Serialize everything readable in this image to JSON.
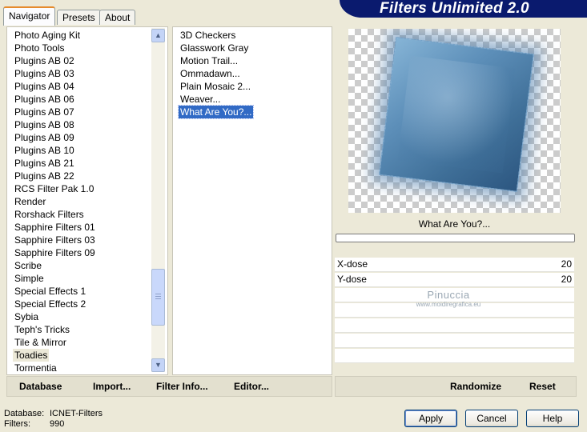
{
  "tabs": [
    "Navigator",
    "Presets",
    "About"
  ],
  "banner_title": "Filters Unlimited 2.0",
  "categories": [
    "Photo Aging Kit",
    "Photo Tools",
    "Plugins AB 02",
    "Plugins AB 03",
    "Plugins AB 04",
    "Plugins AB 06",
    "Plugins AB 07",
    "Plugins AB 08",
    "Plugins AB 09",
    "Plugins AB 10",
    "Plugins AB 21",
    "Plugins AB 22",
    "RCS Filter Pak 1.0",
    "Render",
    "Rorshack Filters",
    "Sapphire Filters 01",
    "Sapphire Filters 03",
    "Sapphire Filters 09",
    "Scribe",
    "Simple",
    "Special Effects 1",
    "Special Effects 2",
    "Sybia",
    "Teph's Tricks",
    "Tile & Mirror",
    "Toadies",
    "Tormentia"
  ],
  "selected_category": "Toadies",
  "filters": [
    "3D Checkers",
    "Glasswork Gray",
    "Motion Trail...",
    "Ommadawn...",
    "Plain Mosaic 2...",
    "Weaver...",
    "What Are You?..."
  ],
  "selected_filter": "What Are You?...",
  "preview_caption": "What Are You?...",
  "params": [
    {
      "label": "X-dose",
      "value": "20"
    },
    {
      "label": "Y-dose",
      "value": "20"
    }
  ],
  "watermark": {
    "name": "Pinuccia",
    "site": "www.moidiregrafica.eu"
  },
  "toolbar": {
    "database": "Database",
    "import": "Import...",
    "filter_info": "Filter Info...",
    "editor": "Editor...",
    "randomize": "Randomize",
    "reset": "Reset"
  },
  "status": {
    "database_label": "Database:",
    "database_value": "ICNET-Filters",
    "filters_label": "Filters:",
    "filters_value": "990"
  },
  "buttons": {
    "apply": "Apply",
    "cancel": "Cancel",
    "help": "Help"
  },
  "scrollbar": {
    "position_fraction": 0.7
  }
}
